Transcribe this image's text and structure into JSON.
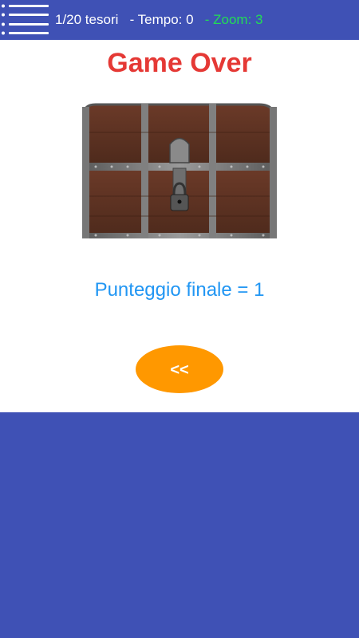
{
  "header": {
    "treasures": "1/20 tesori",
    "time": "- Tempo: 0",
    "zoom": "- Zoom: 3",
    "menu_icon": "hamburger-menu-icon"
  },
  "game_over": {
    "title": "Game Over",
    "image": "treasure-chest",
    "score_text": "Punteggio finale = 1",
    "back_label": "<<"
  },
  "colors": {
    "bar_background": "#3f51b5",
    "title": "#e53935",
    "score": "#2196f3",
    "button": "#ff9800",
    "zoom_text": "#22dd55"
  }
}
